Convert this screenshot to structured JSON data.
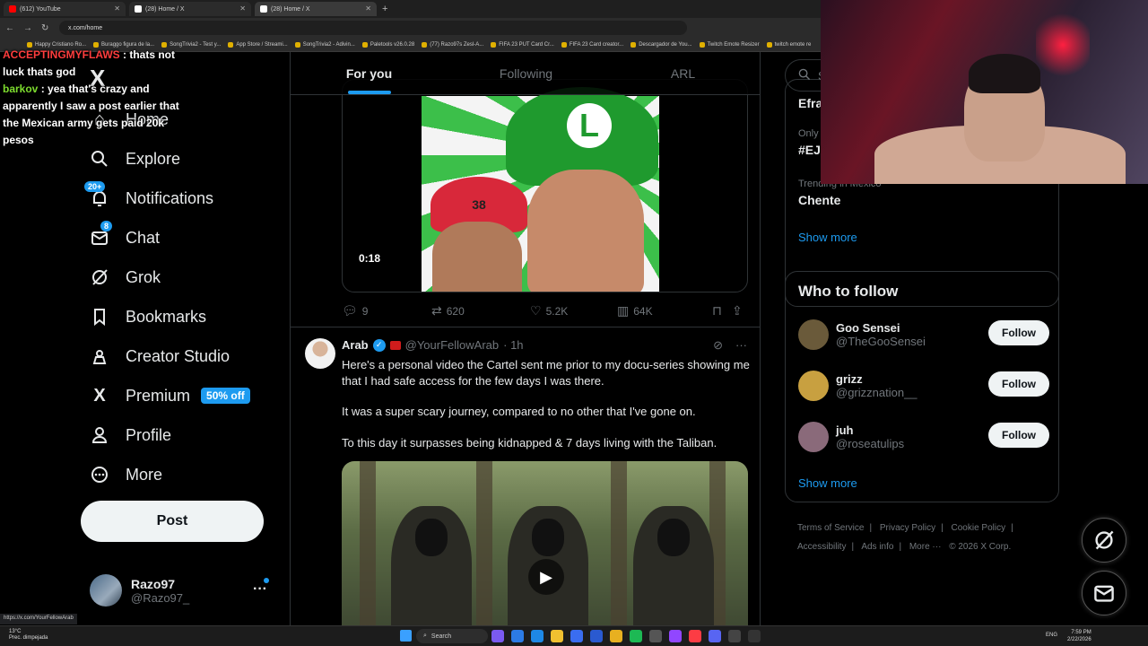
{
  "browser": {
    "tabs": [
      {
        "label": "(612) YouTube",
        "color": "#ff0000"
      },
      {
        "label": "(28) Home / X",
        "color": "#ffffff"
      },
      {
        "label": "(28) Home / X",
        "color": "#ffffff"
      }
    ],
    "url": "x.com/home",
    "bookmarks": [
      "Happy Cristiano Ro...",
      "Buraggo figura de la...",
      "SongTrivia2 - Test y...",
      "App Store / Streami...",
      "SongTrivia2 - Adivin...",
      "Paletools v26.0.28",
      "(77) Razo97s Zesl-A...",
      "FIFA 23 PUT Card Cr...",
      "FIFA 23 Card creator...",
      "Descargador de You...",
      "Twitch Emote Resizer",
      "twitch emote re"
    ]
  },
  "chat": {
    "line1_user": "ACCEPTINGMYFLAWS",
    "line1_text": ": thats not luck thats god",
    "line2_user": "barkov",
    "line2_text": ": yea that's crazy and apparently I saw a post earlier that the Mexican army gets paid 20k pesos"
  },
  "nav": {
    "logo": "X",
    "home": "Home",
    "explore": "Explore",
    "notifications": "Notifications",
    "notifications_badge": "20+",
    "chat": "Chat",
    "chat_badge": "8",
    "grok": "Grok",
    "bookmarks": "Bookmarks",
    "creator_studio": "Creator Studio",
    "premium": "Premium",
    "premium_badge": "50% off",
    "profile": "Profile",
    "more": "More",
    "post": "Post"
  },
  "account": {
    "name": "Razo97",
    "handle": "@Razo97_"
  },
  "feed": {
    "tabs": [
      "For you",
      "Following",
      "ARL"
    ],
    "tweet1": {
      "duration": "0:18",
      "cap_number": "38",
      "cap_letter": "L",
      "replies": "9",
      "reposts": "620",
      "likes": "5.2K",
      "views": "64K"
    },
    "tweet2": {
      "name": "Arab",
      "handle": "@YourFellowArab",
      "time": "· 1h",
      "para1": "Here's a personal video the Cartel sent me prior to my docu-series showing me that I had safe access for the few days I was there.",
      "para2": "It was a super scary journey, compared to no other that I've gone on.",
      "para3": "To this day it surpasses being kidnapped & 7 days living with the Taliban."
    }
  },
  "sidebar": {
    "search_placeholder": "Se",
    "trend1_title": "Efra",
    "trend2_context": "Only",
    "trend2_title": "#EJI",
    "trend3_context": "Trending in México",
    "trend3_title": "Chente",
    "show_more": "Show more",
    "who_to_follow": "Who to follow",
    "suggestions": [
      {
        "name": "Goo Sensei",
        "handle": "@TheGooSensei",
        "follow": "Follow",
        "color": "#6a5a3a"
      },
      {
        "name": "grizz",
        "handle": "@grizznation__",
        "follow": "Follow",
        "color": "#c8a040"
      },
      {
        "name": "juh",
        "handle": "@roseatulips",
        "follow": "Follow",
        "color": "#8a6a7a"
      }
    ],
    "show_more_2": "Show more",
    "footer": [
      "Terms of Service",
      "|",
      "Privacy Policy",
      "|",
      "Cookie Policy",
      "|",
      "Accessibility",
      "|",
      "Ads info",
      "|",
      "More ···",
      "© 2026 X Corp."
    ]
  },
  "status_link": "https://x.com/YourFellowArab",
  "taskbar": {
    "temp": "13°C",
    "weather": "Prec. dimpejada",
    "search": "Search",
    "lang": "ENG",
    "time": "7:59 PM",
    "date": "2/22/2026"
  }
}
